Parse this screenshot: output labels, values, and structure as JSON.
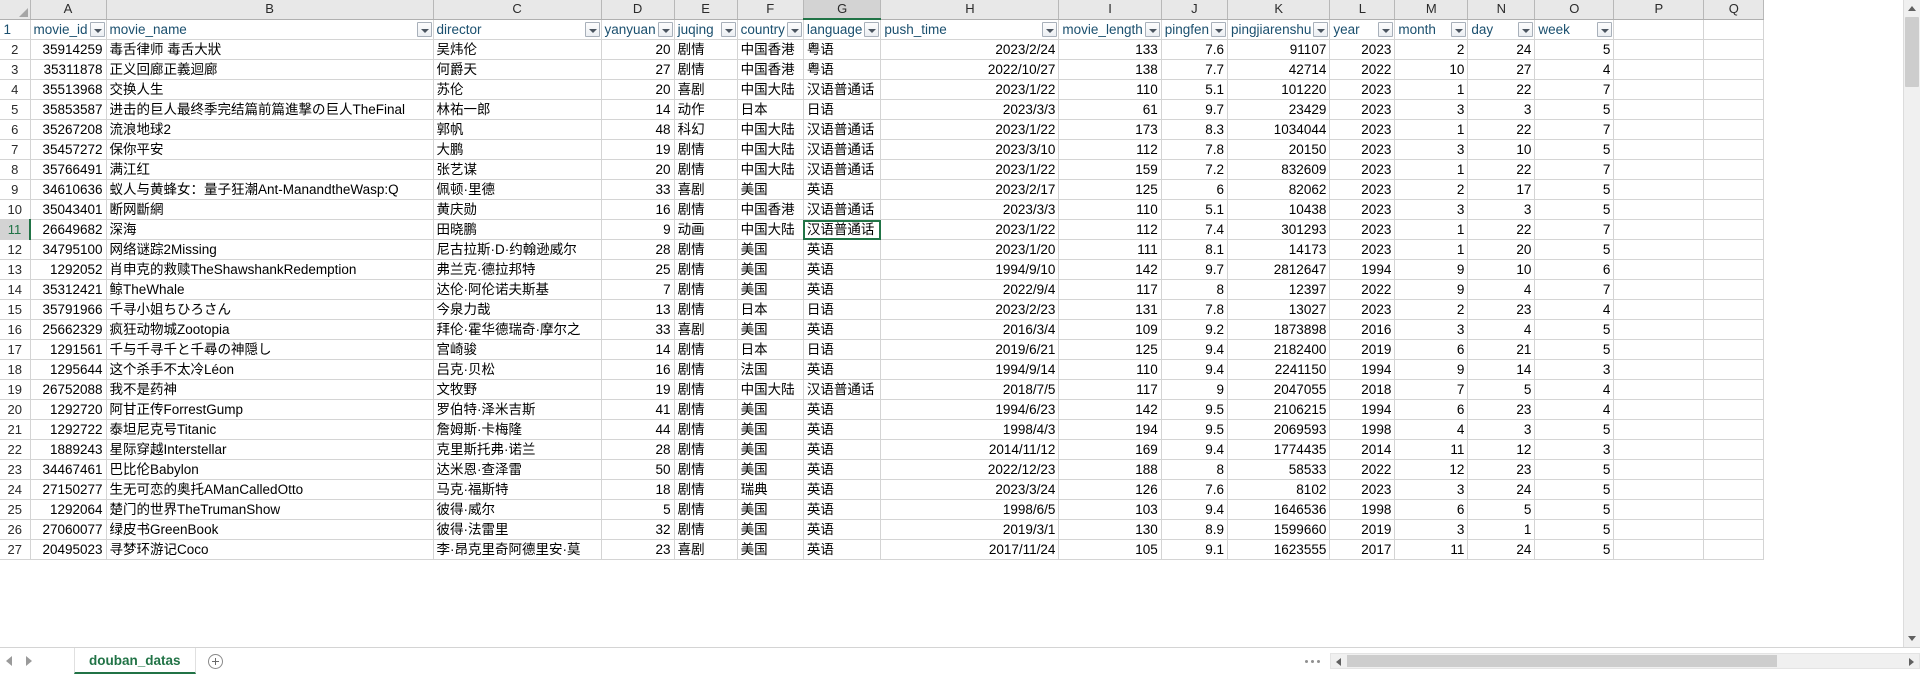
{
  "app": {
    "sheet_tab": "douban_datas",
    "add_sheet_icon": "plus-circle-icon",
    "nav_prev_icon": "triangle-left-icon",
    "nav_next_icon": "triangle-right-icon",
    "select_all_icon": "select-all-corner-icon",
    "scroll_up_icon": "triangle-up-icon",
    "scroll_down_icon": "triangle-down-icon",
    "scroll_left_icon": "triangle-left-icon",
    "scroll_right_icon": "triangle-right-icon",
    "filter_icon": "filter-dropdown-icon",
    "accent_color": "#217346",
    "header_text_color": "#1a4f6e",
    "grid_line_color": "#d4d4d4",
    "header_fill_color": "#e8e8e8"
  },
  "grid": {
    "column_letters": [
      "A",
      "B",
      "C",
      "D",
      "E",
      "F",
      "G",
      "H",
      "I",
      "J",
      "K",
      "L",
      "M",
      "N",
      "O",
      "P",
      "Q"
    ],
    "active_column_letter": "G",
    "active_row_number": "11",
    "selected_cell": {
      "row": 11,
      "column": "G",
      "value": "汉语普通话"
    },
    "row_numbers": [
      "1",
      "2",
      "3",
      "4",
      "5",
      "6",
      "7",
      "8",
      "9",
      "10",
      "11",
      "12",
      "13",
      "14",
      "15",
      "16",
      "17",
      "18",
      "19",
      "20",
      "21",
      "22",
      "23",
      "24",
      "25",
      "26",
      "27"
    ],
    "headers": [
      "movie_id",
      "movie_name",
      "director",
      "yanyuan",
      "juqing",
      "country",
      "language",
      "push_time",
      "movie_length",
      "pingfen",
      "pingjiarenshu",
      "year",
      "month",
      "day",
      "week"
    ],
    "rows": [
      {
        "movie_id": "35914259",
        "movie_name": "毒舌律师 毒舌大狀",
        "director": "吴炜伦",
        "yanyuan": "20",
        "juqing": "剧情",
        "country": "中国香港",
        "language": "粤语",
        "push_time": "2023/2/24",
        "movie_length": "133",
        "pingfen": "7.6",
        "pingjiarenshu": "91107",
        "year": "2023",
        "month": "2",
        "day": "24",
        "week": "5"
      },
      {
        "movie_id": "35311878",
        "movie_name": "正义回廊正義迴廊",
        "director": "何爵天",
        "yanyuan": "27",
        "juqing": "剧情",
        "country": "中国香港",
        "language": "粤语",
        "push_time": "2022/10/27",
        "movie_length": "138",
        "pingfen": "7.7",
        "pingjiarenshu": "42714",
        "year": "2022",
        "month": "10",
        "day": "27",
        "week": "4"
      },
      {
        "movie_id": "35513968",
        "movie_name": "交换人生",
        "director": "苏伦",
        "yanyuan": "20",
        "juqing": "喜剧",
        "country": "中国大陆",
        "language": "汉语普通话",
        "push_time": "2023/1/22",
        "movie_length": "110",
        "pingfen": "5.1",
        "pingjiarenshu": "101220",
        "year": "2023",
        "month": "1",
        "day": "22",
        "week": "7"
      },
      {
        "movie_id": "35853587",
        "movie_name": "进击的巨人最终季完结篇前篇進撃の巨人TheFinal",
        "director": "林祐一郎",
        "yanyuan": "14",
        "juqing": "动作",
        "country": "日本",
        "language": "日语",
        "push_time": "2023/3/3",
        "movie_length": "61",
        "pingfen": "9.7",
        "pingjiarenshu": "23429",
        "year": "2023",
        "month": "3",
        "day": "3",
        "week": "5"
      },
      {
        "movie_id": "35267208",
        "movie_name": "流浪地球2",
        "director": "郭帆",
        "yanyuan": "48",
        "juqing": "科幻",
        "country": "中国大陆",
        "language": "汉语普通话",
        "push_time": "2023/1/22",
        "movie_length": "173",
        "pingfen": "8.3",
        "pingjiarenshu": "1034044",
        "year": "2023",
        "month": "1",
        "day": "22",
        "week": "7"
      },
      {
        "movie_id": "35457272",
        "movie_name": "保你平安",
        "director": "大鹏",
        "yanyuan": "19",
        "juqing": "剧情",
        "country": "中国大陆",
        "language": "汉语普通话",
        "push_time": "2023/3/10",
        "movie_length": "112",
        "pingfen": "7.8",
        "pingjiarenshu": "20150",
        "year": "2023",
        "month": "3",
        "day": "10",
        "week": "5"
      },
      {
        "movie_id": "35766491",
        "movie_name": "满江红",
        "director": "张艺谋",
        "yanyuan": "20",
        "juqing": "剧情",
        "country": "中国大陆",
        "language": "汉语普通话",
        "push_time": "2023/1/22",
        "movie_length": "159",
        "pingfen": "7.2",
        "pingjiarenshu": "832609",
        "year": "2023",
        "month": "1",
        "day": "22",
        "week": "7"
      },
      {
        "movie_id": "34610636",
        "movie_name": "蚁人与黄蜂女：量子狂潮Ant-ManandtheWasp:Q",
        "director": "佩顿·里德",
        "yanyuan": "33",
        "juqing": "喜剧",
        "country": "美国",
        "language": "英语",
        "push_time": "2023/2/17",
        "movie_length": "125",
        "pingfen": "6",
        "pingjiarenshu": "82062",
        "year": "2023",
        "month": "2",
        "day": "17",
        "week": "5"
      },
      {
        "movie_id": "35043401",
        "movie_name": "断网斷網",
        "director": "黄庆勋",
        "yanyuan": "16",
        "juqing": "剧情",
        "country": "中国香港",
        "language": "汉语普通话",
        "push_time": "2023/3/3",
        "movie_length": "110",
        "pingfen": "5.1",
        "pingjiarenshu": "10438",
        "year": "2023",
        "month": "3",
        "day": "3",
        "week": "5"
      },
      {
        "movie_id": "26649682",
        "movie_name": "深海",
        "director": "田晓鹏",
        "yanyuan": "9",
        "juqing": "动画",
        "country": "中国大陆",
        "language": "汉语普通话",
        "push_time": "2023/1/22",
        "movie_length": "112",
        "pingfen": "7.4",
        "pingjiarenshu": "301293",
        "year": "2023",
        "month": "1",
        "day": "22",
        "week": "7"
      },
      {
        "movie_id": "34795100",
        "movie_name": "网络谜踪2Missing",
        "director": "尼古拉斯·D·约翰逊威尔",
        "yanyuan": "28",
        "juqing": "剧情",
        "country": "美国",
        "language": "英语",
        "push_time": "2023/1/20",
        "movie_length": "111",
        "pingfen": "8.1",
        "pingjiarenshu": "14173",
        "year": "2023",
        "month": "1",
        "day": "20",
        "week": "5"
      },
      {
        "movie_id": "1292052",
        "movie_name": "肖申克的救赎TheShawshankRedemption",
        "director": "弗兰克·德拉邦特",
        "yanyuan": "25",
        "juqing": "剧情",
        "country": "美国",
        "language": "英语",
        "push_time": "1994/9/10",
        "movie_length": "142",
        "pingfen": "9.7",
        "pingjiarenshu": "2812647",
        "year": "1994",
        "month": "9",
        "day": "10",
        "week": "6"
      },
      {
        "movie_id": "35312421",
        "movie_name": "鲸TheWhale",
        "director": "达伦·阿伦诺夫斯基",
        "yanyuan": "7",
        "juqing": "剧情",
        "country": "美国",
        "language": "英语",
        "push_time": "2022/9/4",
        "movie_length": "117",
        "pingfen": "8",
        "pingjiarenshu": "12397",
        "year": "2022",
        "month": "9",
        "day": "4",
        "week": "7"
      },
      {
        "movie_id": "35791966",
        "movie_name": "千寻小姐ちひろさん",
        "director": "今泉力哉",
        "yanyuan": "13",
        "juqing": "剧情",
        "country": "日本",
        "language": "日语",
        "push_time": "2023/2/23",
        "movie_length": "131",
        "pingfen": "7.8",
        "pingjiarenshu": "13027",
        "year": "2023",
        "month": "2",
        "day": "23",
        "week": "4"
      },
      {
        "movie_id": "25662329",
        "movie_name": "疯狂动物城Zootopia",
        "director": "拜伦·霍华德瑞奇·摩尔之",
        "yanyuan": "33",
        "juqing": "喜剧",
        "country": "美国",
        "language": "英语",
        "push_time": "2016/3/4",
        "movie_length": "109",
        "pingfen": "9.2",
        "pingjiarenshu": "1873898",
        "year": "2016",
        "month": "3",
        "day": "4",
        "week": "5"
      },
      {
        "movie_id": "1291561",
        "movie_name": "千与千寻千と千尋の神隠し",
        "director": "宫崎骏",
        "yanyuan": "14",
        "juqing": "剧情",
        "country": "日本",
        "language": "日语",
        "push_time": "2019/6/21",
        "movie_length": "125",
        "pingfen": "9.4",
        "pingjiarenshu": "2182400",
        "year": "2019",
        "month": "6",
        "day": "21",
        "week": "5"
      },
      {
        "movie_id": "1295644",
        "movie_name": "这个杀手不太冷Léon",
        "director": "吕克·贝松",
        "yanyuan": "16",
        "juqing": "剧情",
        "country": "法国",
        "language": "英语",
        "push_time": "1994/9/14",
        "movie_length": "110",
        "pingfen": "9.4",
        "pingjiarenshu": "2241150",
        "year": "1994",
        "month": "9",
        "day": "14",
        "week": "3"
      },
      {
        "movie_id": "26752088",
        "movie_name": "我不是药神",
        "director": "文牧野",
        "yanyuan": "19",
        "juqing": "剧情",
        "country": "中国大陆",
        "language": "汉语普通话",
        "push_time": "2018/7/5",
        "movie_length": "117",
        "pingfen": "9",
        "pingjiarenshu": "2047055",
        "year": "2018",
        "month": "7",
        "day": "5",
        "week": "4"
      },
      {
        "movie_id": "1292720",
        "movie_name": "阿甘正传ForrestGump",
        "director": "罗伯特·泽米吉斯",
        "yanyuan": "41",
        "juqing": "剧情",
        "country": "美国",
        "language": "英语",
        "push_time": "1994/6/23",
        "movie_length": "142",
        "pingfen": "9.5",
        "pingjiarenshu": "2106215",
        "year": "1994",
        "month": "6",
        "day": "23",
        "week": "4"
      },
      {
        "movie_id": "1292722",
        "movie_name": "泰坦尼克号Titanic",
        "director": "詹姆斯·卡梅隆",
        "yanyuan": "44",
        "juqing": "剧情",
        "country": "美国",
        "language": "英语",
        "push_time": "1998/4/3",
        "movie_length": "194",
        "pingfen": "9.5",
        "pingjiarenshu": "2069593",
        "year": "1998",
        "month": "4",
        "day": "3",
        "week": "5"
      },
      {
        "movie_id": "1889243",
        "movie_name": "星际穿越Interstellar",
        "director": "克里斯托弗·诺兰",
        "yanyuan": "28",
        "juqing": "剧情",
        "country": "美国",
        "language": "英语",
        "push_time": "2014/11/12",
        "movie_length": "169",
        "pingfen": "9.4",
        "pingjiarenshu": "1774435",
        "year": "2014",
        "month": "11",
        "day": "12",
        "week": "3"
      },
      {
        "movie_id": "34467461",
        "movie_name": "巴比伦Babylon",
        "director": "达米恩·查泽雷",
        "yanyuan": "50",
        "juqing": "剧情",
        "country": "美国",
        "language": "英语",
        "push_time": "2022/12/23",
        "movie_length": "188",
        "pingfen": "8",
        "pingjiarenshu": "58533",
        "year": "2022",
        "month": "12",
        "day": "23",
        "week": "5"
      },
      {
        "movie_id": "27150277",
        "movie_name": "生无可恋的奥托AManCalledOtto",
        "director": "马克·福斯特",
        "yanyuan": "18",
        "juqing": "剧情",
        "country": "瑞典",
        "language": "英语",
        "push_time": "2023/3/24",
        "movie_length": "126",
        "pingfen": "7.6",
        "pingjiarenshu": "8102",
        "year": "2023",
        "month": "3",
        "day": "24",
        "week": "5"
      },
      {
        "movie_id": "1292064",
        "movie_name": "楚门的世界TheTrumanShow",
        "director": "彼得·威尔",
        "yanyuan": "5",
        "juqing": "剧情",
        "country": "美国",
        "language": "英语",
        "push_time": "1998/6/5",
        "movie_length": "103",
        "pingfen": "9.4",
        "pingjiarenshu": "1646536",
        "year": "1998",
        "month": "6",
        "day": "5",
        "week": "5"
      },
      {
        "movie_id": "27060077",
        "movie_name": "绿皮书GreenBook",
        "director": "彼得·法雷里",
        "yanyuan": "32",
        "juqing": "剧情",
        "country": "美国",
        "language": "英语",
        "push_time": "2019/3/1",
        "movie_length": "130",
        "pingfen": "8.9",
        "pingjiarenshu": "1599660",
        "year": "2019",
        "month": "3",
        "day": "1",
        "week": "5"
      },
      {
        "movie_id": "20495023",
        "movie_name": "寻梦环游记Coco",
        "director": "李·昂克里奇阿德里安·莫",
        "yanyuan": "23",
        "juqing": "喜剧",
        "country": "美国",
        "language": "英语",
        "push_time": "2017/11/24",
        "movie_length": "105",
        "pingfen": "9.1",
        "pingjiarenshu": "1623555",
        "year": "2017",
        "month": "11",
        "day": "24",
        "week": "5"
      }
    ]
  }
}
